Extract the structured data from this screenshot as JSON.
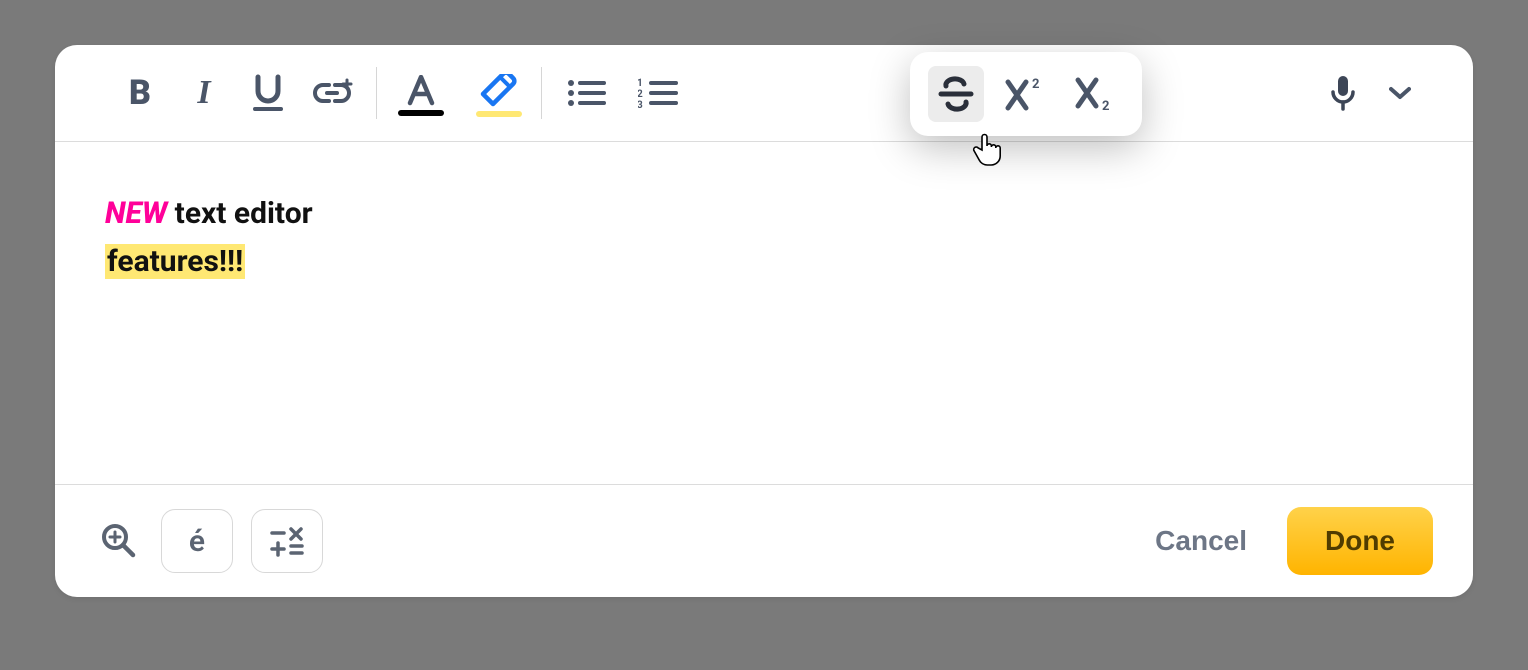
{
  "toolbar": {
    "bold": "B",
    "italic": "I",
    "underline": "U"
  },
  "content": {
    "new_word": "NEW",
    "rest_line1": " text editor",
    "line2": "features!!!"
  },
  "footer": {
    "accent_char": "é",
    "cancel": "Cancel",
    "done": "Done"
  }
}
